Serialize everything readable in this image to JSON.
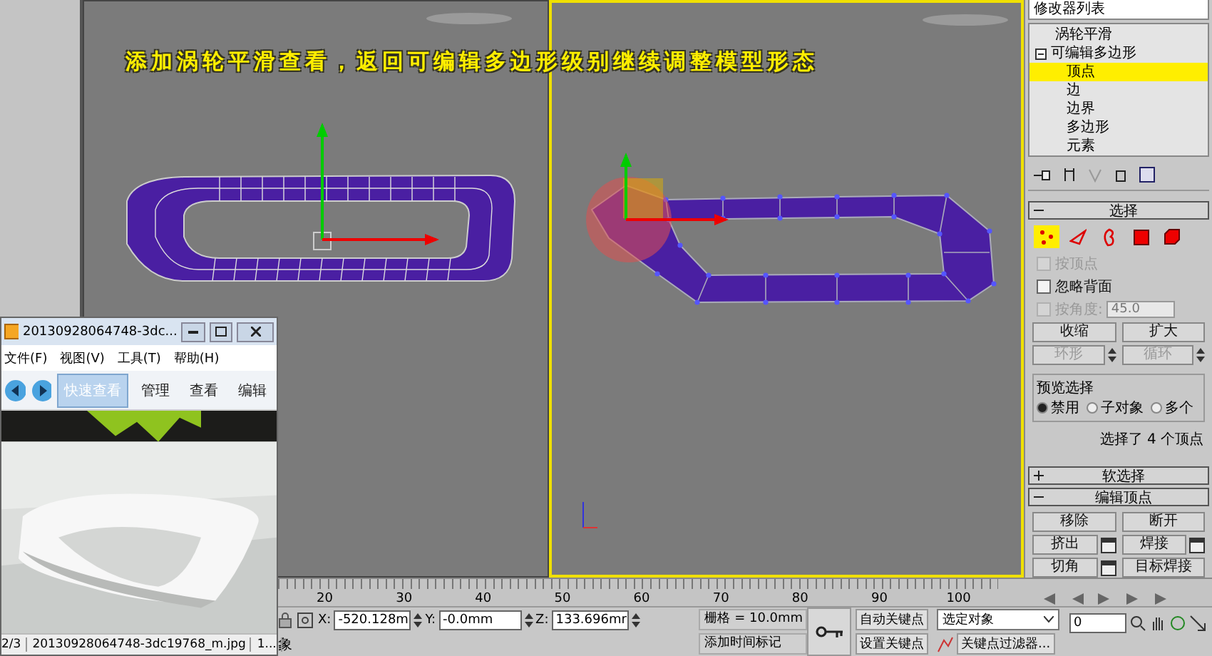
{
  "caption": "添加涡轮平滑查看，返回可编辑多边形级别继续调整模型形态",
  "command_panel": {
    "modifier_list": "修改器列表",
    "stack": [
      {
        "label": "涡轮平滑",
        "selected": false
      },
      {
        "label": "可编辑多边形",
        "selected": false,
        "expanded": true,
        "children": [
          {
            "label": "顶点",
            "selected": true
          },
          {
            "label": "边",
            "selected": false
          },
          {
            "label": "边界",
            "selected": false
          },
          {
            "label": "多边形",
            "selected": false
          },
          {
            "label": "元素",
            "selected": false
          }
        ]
      }
    ],
    "selection": {
      "title": "选择",
      "expanded": true,
      "levels": [
        {
          "kind": "vertex",
          "selected": true
        },
        {
          "kind": "edge",
          "selected": false
        },
        {
          "kind": "border",
          "selected": false
        },
        {
          "kind": "polygon",
          "selected": false
        },
        {
          "kind": "element",
          "selected": false
        }
      ],
      "options": [
        {
          "label": "按顶点",
          "checked": false,
          "disabled": true
        },
        {
          "label": "忽略背面",
          "checked": false,
          "disabled": false
        },
        {
          "label": "按角度:",
          "checked": false,
          "disabled": true,
          "value": "45.0"
        }
      ],
      "buttons": [
        {
          "label": "收缩",
          "disabled": false,
          "spinner": false
        },
        {
          "label": "扩大",
          "disabled": false,
          "spinner": false
        },
        {
          "label": "环形",
          "disabled": true,
          "spinner": true
        },
        {
          "label": "循环",
          "disabled": true,
          "spinner": true
        }
      ],
      "preview": {
        "title": "预览选择",
        "options": [
          {
            "label": "禁用",
            "selected": true
          },
          {
            "label": "子对象",
            "selected": false
          },
          {
            "label": "多个",
            "selected": false
          }
        ]
      },
      "status": "选择了 4 个顶点"
    },
    "soft_selection": {
      "title": "软选择",
      "expanded": false
    },
    "edit_vertices": {
      "title": "编辑顶点",
      "expanded": true,
      "buttons": [
        {
          "label": "移除",
          "settings": false
        },
        {
          "label": "断开",
          "settings": false
        },
        {
          "label": "挤出",
          "settings": true
        },
        {
          "label": "焊接",
          "settings": true
        },
        {
          "label": "切角",
          "settings": true
        },
        {
          "label": "目标焊接",
          "settings": false
        }
      ]
    }
  },
  "image_viewer": {
    "title": "20130928064748-3dc...",
    "menu": [
      "文件(F)",
      "视图(V)",
      "工具(T)",
      "帮助(H)"
    ],
    "tabs": [
      {
        "label": "快速查看",
        "selected": true
      },
      {
        "label": "管理",
        "selected": false
      },
      {
        "label": "查看",
        "selected": false
      },
      {
        "label": "编辑",
        "selected": false
      }
    ],
    "status": [
      "2/3",
      "20130928064748-3dc19768_m.jpg",
      "1..."
    ]
  },
  "timeline": {
    "ticks": [
      "20",
      "30",
      "40",
      "50",
      "60",
      "70",
      "80",
      "90",
      "100"
    ],
    "frame": "0"
  },
  "status_bar": {
    "prompt": "象",
    "coords": [
      {
        "axis": "X:",
        "value": "-520.128m"
      },
      {
        "axis": "Y:",
        "value": "-0.0mm"
      },
      {
        "axis": "Z:",
        "value": "133.696mr"
      }
    ],
    "grid": "栅格 = 10.0mm",
    "add_time_tag": "添加时间标记",
    "auto_key": "自动关键点",
    "set_key": "设置关键点",
    "key_mode": "选定对象",
    "key_filters": "关键点过滤器..."
  }
}
